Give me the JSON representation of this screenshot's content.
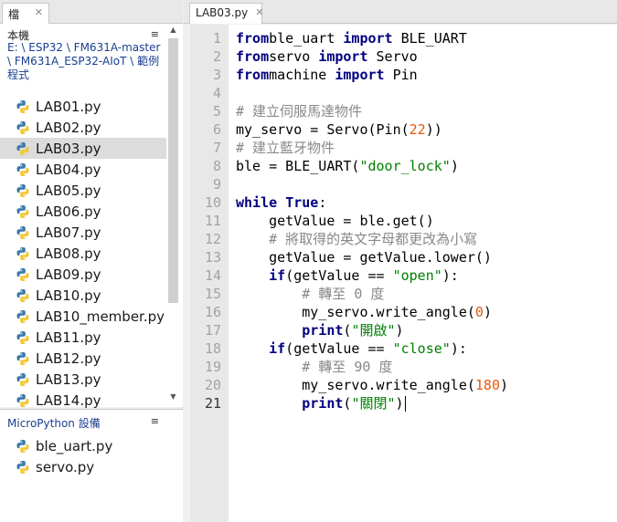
{
  "left_tabbar": {
    "files_tab": "檔案",
    "close_glyph": "✕"
  },
  "local": {
    "label": "本機",
    "path": "E: \\ ESP32 \\ FM631A-master \\ FM631A_ESP32-AIoT \\ 範例程式",
    "files": [
      "LAB01.py",
      "LAB02.py",
      "LAB03.py",
      "LAB04.py",
      "LAB05.py",
      "LAB06.py",
      "LAB07.py",
      "LAB08.py",
      "LAB09.py",
      "LAB10.py",
      "LAB10_member.py",
      "LAB11.py",
      "LAB12.py",
      "LAB13.py",
      "LAB14.py"
    ],
    "selected": "LAB03.py"
  },
  "device": {
    "title": "MicroPython 設備",
    "files": [
      "ble_uart.py",
      "servo.py"
    ]
  },
  "panel_menu_glyph": "≡",
  "editor": {
    "tab": "LAB03.py",
    "close_glyph": "✕",
    "current_line": 21,
    "lines": [
      [
        [
          "kw",
          "from"
        ],
        [
          "",
          "ble_uart "
        ],
        [
          "kw",
          "import"
        ],
        [
          "",
          " BLE_UART"
        ]
      ],
      [
        [
          "kw",
          "from"
        ],
        [
          "",
          "servo "
        ],
        [
          "kw",
          "import"
        ],
        [
          "",
          " Servo"
        ]
      ],
      [
        [
          "kw",
          "from"
        ],
        [
          "",
          "machine "
        ],
        [
          "kw",
          "import"
        ],
        [
          "",
          " Pin"
        ]
      ],
      [],
      [
        [
          "cmt",
          "# 建立伺服馬達物件"
        ]
      ],
      [
        [
          "",
          "my_servo = Servo(Pin("
        ],
        [
          "num",
          "22"
        ],
        [
          "",
          "))"
        ]
      ],
      [
        [
          "cmt",
          "# 建立藍牙物件"
        ]
      ],
      [
        [
          "",
          "ble = BLE_UART("
        ],
        [
          "str",
          "\"door_lock\""
        ],
        [
          "",
          ")"
        ]
      ],
      [],
      [
        [
          "kw",
          "while"
        ],
        [
          "",
          " "
        ],
        [
          "kw",
          "True"
        ],
        [
          "",
          ":"
        ]
      ],
      [
        [
          "",
          "    getValue = ble.get()"
        ]
      ],
      [
        [
          "cmt",
          "    # 將取得的英文字母都更改為小寫"
        ]
      ],
      [
        [
          "",
          "    getValue = getValue.lower()"
        ]
      ],
      [
        [
          "",
          "    "
        ],
        [
          "kw",
          "if"
        ],
        [
          "",
          "(getValue == "
        ],
        [
          "str",
          "\"open\""
        ],
        [
          "",
          "):"
        ]
      ],
      [
        [
          "cmt",
          "        # 轉至 0 度"
        ]
      ],
      [
        [
          "",
          "        my_servo.write_angle("
        ],
        [
          "num",
          "0"
        ],
        [
          "",
          ")"
        ]
      ],
      [
        [
          "",
          "        "
        ],
        [
          "kw",
          "print"
        ],
        [
          "",
          "("
        ],
        [
          "str",
          "\"開啟\""
        ],
        [
          "",
          ")"
        ]
      ],
      [
        [
          "",
          "    "
        ],
        [
          "kw",
          "if"
        ],
        [
          "",
          "(getValue == "
        ],
        [
          "str",
          "\"close\""
        ],
        [
          "",
          "):"
        ]
      ],
      [
        [
          "cmt",
          "        # 轉至 90 度"
        ]
      ],
      [
        [
          "",
          "        my_servo.write_angle("
        ],
        [
          "num",
          "180"
        ],
        [
          "",
          ")"
        ]
      ],
      [
        [
          "",
          "        "
        ],
        [
          "kw",
          "print"
        ],
        [
          "",
          "("
        ],
        [
          "str",
          "\"關閉\""
        ],
        [
          "",
          ")"
        ]
      ]
    ]
  }
}
